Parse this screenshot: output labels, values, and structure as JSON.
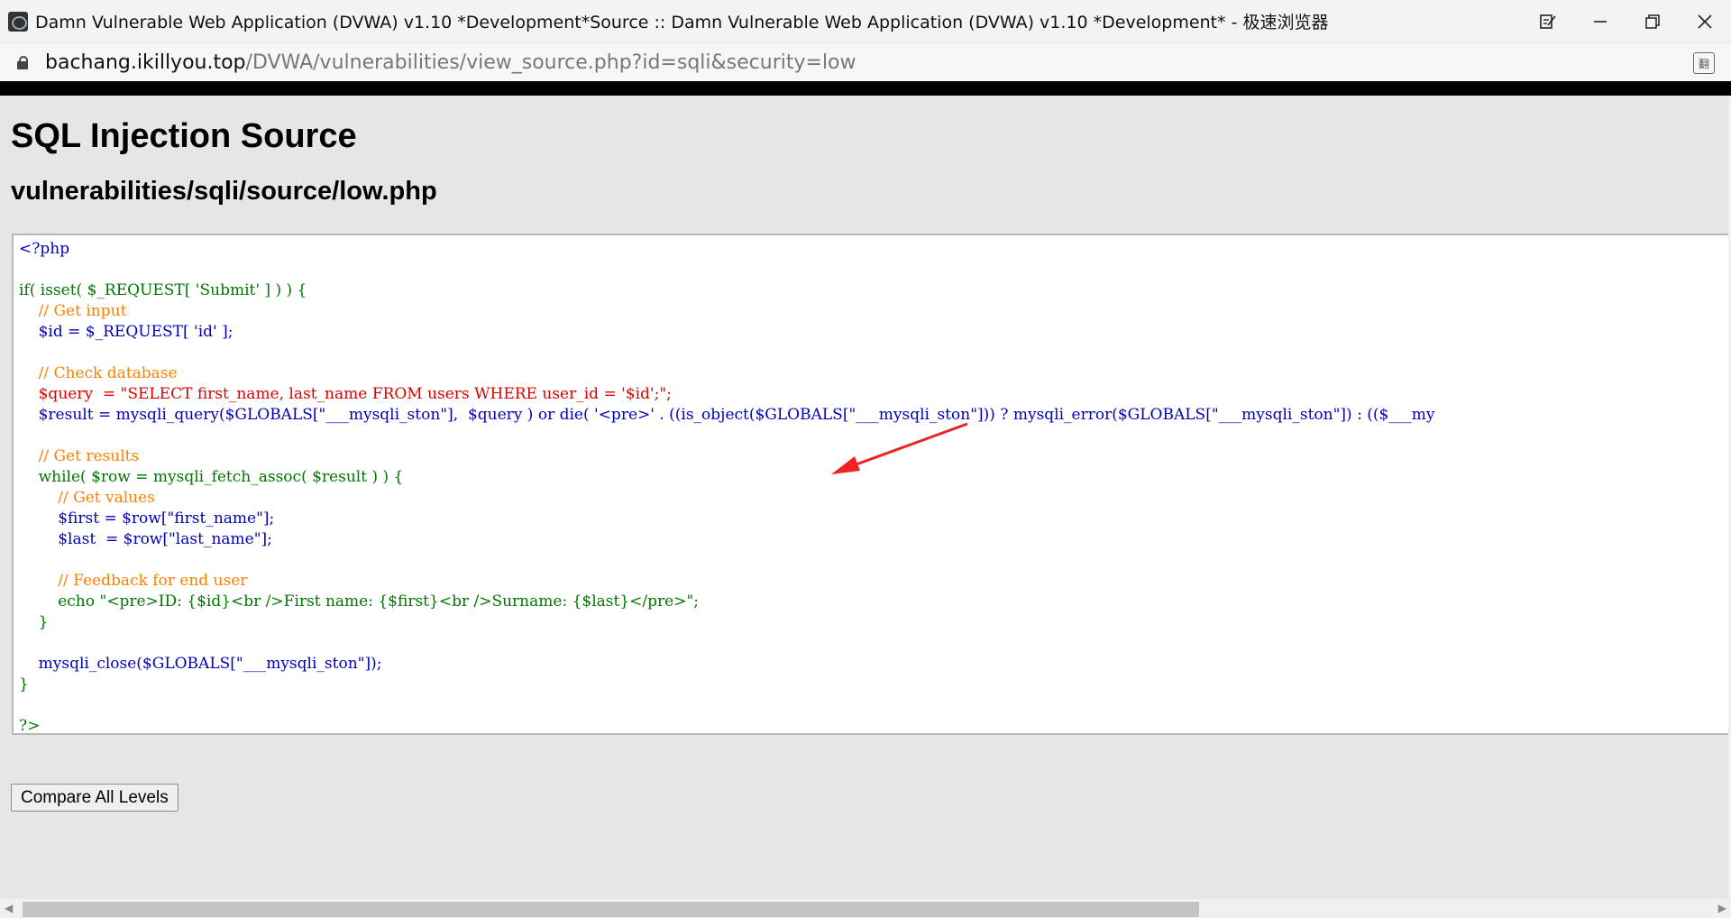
{
  "window": {
    "title": "Damn Vulnerable Web Application (DVWA) v1.10 *Development*Source :: Damn Vulnerable Web Application (DVWA) v1.10 *Development* - 极速浏览器",
    "controls": {
      "edit": "⌕",
      "minimize": "—",
      "restore": "❐",
      "close": "✕"
    }
  },
  "address": {
    "host": "bachang.ikillyou.top",
    "path": "/DVWA/vulnerabilities/view_source.php?id=sqli&security=low",
    "translate_icon": "翻"
  },
  "page": {
    "heading": "SQL Injection Source",
    "subheading": "vulnerabilities/sqli/source/low.php"
  },
  "code": [
    "<?php",
    "",
    "if( isset( $_REQUEST[ 'Submit' ] ) ) {",
    "    // Get input",
    "    $id = $_REQUEST[ 'id' ];",
    "",
    "    // Check database",
    "    $query  = \"SELECT first_name, last_name FROM users WHERE user_id = '$id';\";",
    "    $result = mysqli_query($GLOBALS[\"___mysqli_ston\"],  $query ) or die( '<pre>' . ((is_object($GLOBALS[\"___mysqli_ston\"])) ? mysqli_error($GLOBALS[\"___mysqli_ston\"]) : (($___my",
    "",
    "    // Get results",
    "    while( $row = mysqli_fetch_assoc( $result ) ) {",
    "        // Get values",
    "        $first = $row[\"first_name\"];",
    "        $last  = $row[\"last_name\"];",
    "",
    "        // Feedback for end user",
    "        echo \"<pre>ID: {$id}<br />First name: {$first}<br />Surname: {$last}</pre>\";",
    "    }",
    "",
    "    mysqli_close($GLOBALS[\"___mysqli_ston\"]);",
    "}",
    "",
    "?>"
  ],
  "buttons": {
    "compare": "Compare All Levels"
  },
  "colors": {
    "keyword": "#007700",
    "variable": "#0000bb",
    "string": "#dd0000",
    "comment": "#ff8000",
    "arrow": "#ee2222"
  }
}
